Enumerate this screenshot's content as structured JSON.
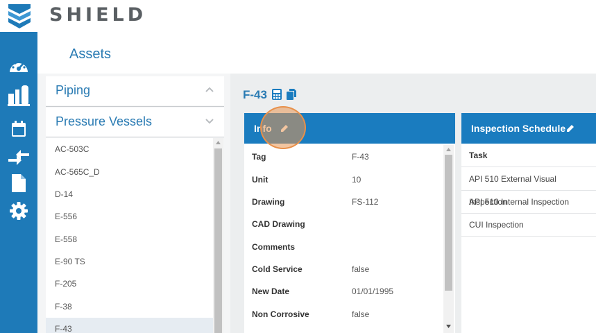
{
  "app": {
    "brand": "SHIELD",
    "colors": {
      "primary": "#1e7ab8",
      "accent": "#2a7bb3",
      "header": "#1a7cbf",
      "click_indicator": "#e8904a"
    }
  },
  "nav": {
    "items": [
      {
        "icon": "dashboard-gauge-icon"
      },
      {
        "icon": "facility-icon"
      },
      {
        "icon": "calendar-icon"
      },
      {
        "icon": "swap-arrows-icon"
      },
      {
        "icon": "document-icon"
      },
      {
        "icon": "gear-icon"
      }
    ]
  },
  "page": {
    "title": "Assets"
  },
  "asset_types": {
    "piping": "Piping",
    "pressure_vessels": "Pressure Vessels"
  },
  "asset_list": {
    "items": [
      "AC-503C",
      "AC-565C_D",
      "D-14",
      "E-556",
      "E-558",
      "E-90 TS",
      "F-205",
      "F-38",
      "F-43"
    ],
    "selected": "F-43"
  },
  "asset_detail": {
    "name": "F-43",
    "header_icons": [
      "calculator-icon",
      "copy-icon"
    ]
  },
  "info": {
    "title": "Info",
    "rows": [
      {
        "key": "Tag",
        "value": "F-43"
      },
      {
        "key": "Unit",
        "value": "10"
      },
      {
        "key": "Drawing",
        "value": "FS-112"
      },
      {
        "key": "CAD Drawing",
        "value": ""
      },
      {
        "key": "Comments",
        "value": ""
      },
      {
        "key": "Cold Service",
        "value": "false"
      },
      {
        "key": "New Date",
        "value": "01/01/1995"
      },
      {
        "key": "Non Corrosive",
        "value": "false"
      }
    ]
  },
  "inspection_schedule": {
    "title": "Inspection Schedule",
    "column": "Task",
    "tasks": [
      "API 510 External Visual Inspection",
      "API 510 Internal Inspection",
      "CUI Inspection"
    ]
  }
}
